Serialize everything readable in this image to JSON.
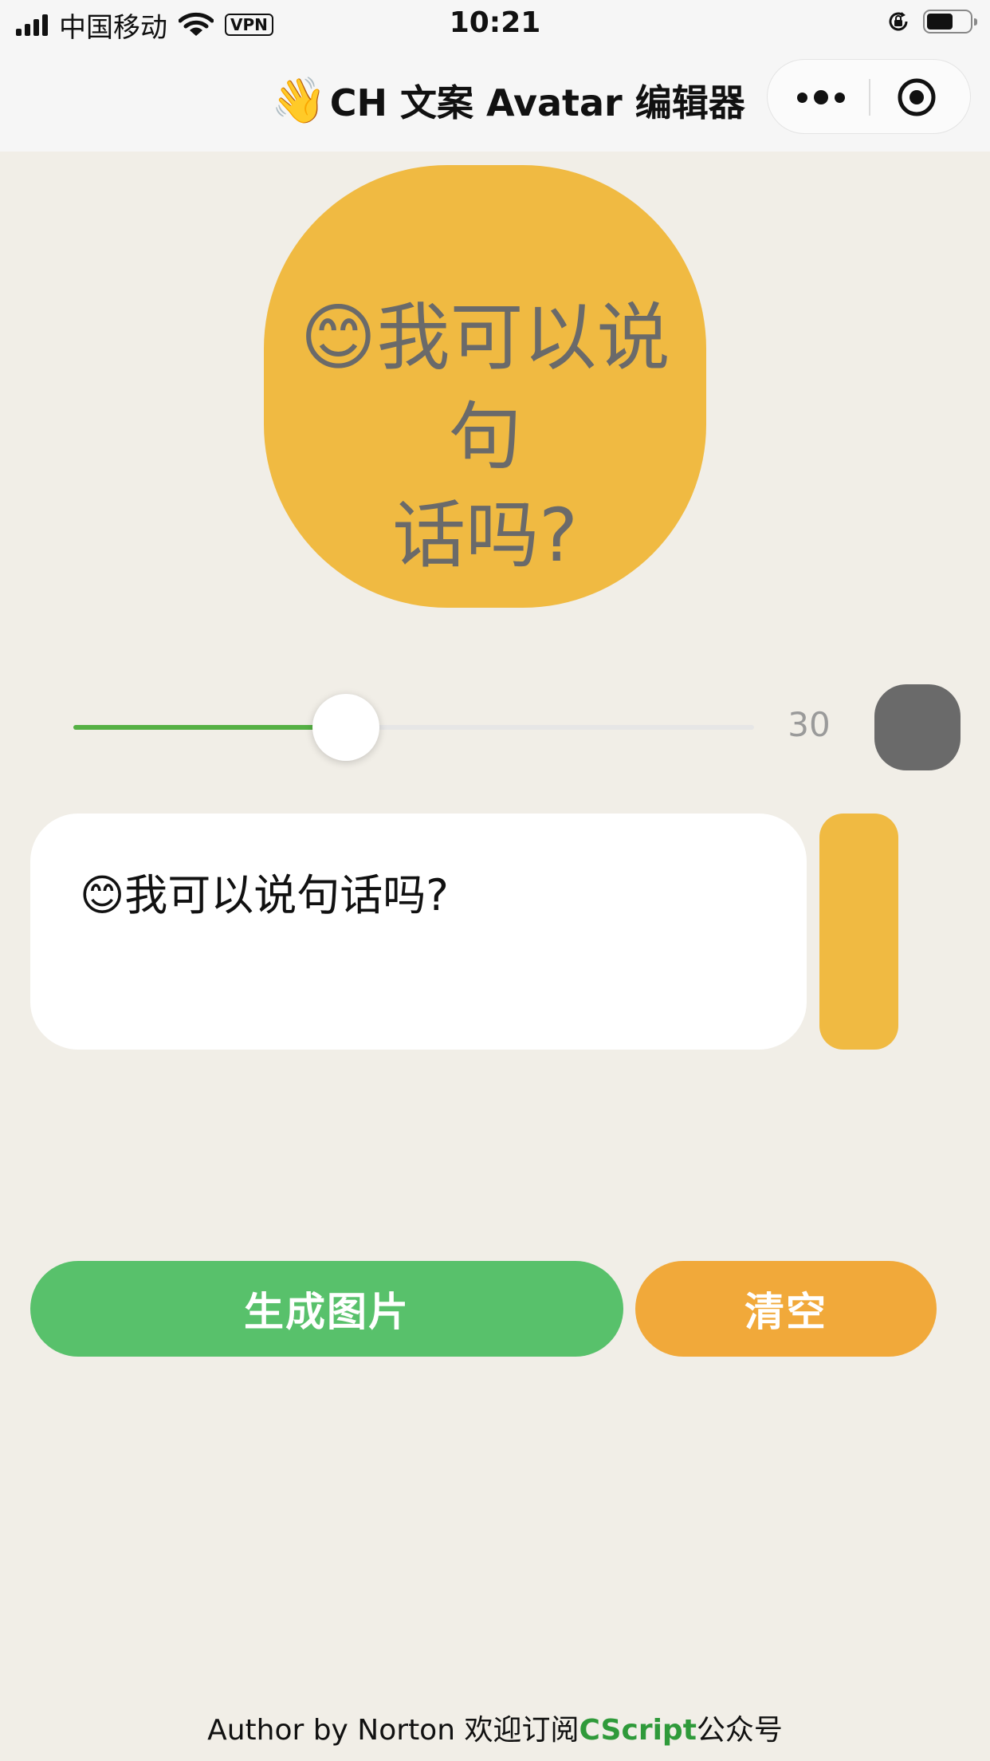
{
  "status_bar": {
    "carrier": "中国移动",
    "vpn": "VPN",
    "time": "10:21",
    "battery_level": 0.6
  },
  "nav": {
    "title_emoji": "👋",
    "title": "CH 文案 Avatar 编辑器"
  },
  "preview": {
    "line1": "😊我可以说句",
    "line2": "话吗?",
    "background_color": "#f0ba42",
    "text_color": "#6a6a6a"
  },
  "font_size_slider": {
    "value": "30",
    "fill_fraction": 0.4,
    "text_color_swatch": "#6a6a6a"
  },
  "editor": {
    "text": "😊我可以说句话吗?",
    "bg_color_swatch": "#f0ba42"
  },
  "buttons": {
    "generate": "生成图片",
    "clear": "清空"
  },
  "footer": {
    "prefix": "Author by Norton 欢迎订阅",
    "accent": "CScript",
    "suffix": "公众号"
  },
  "icons": [
    "signal-icon",
    "wifi-icon",
    "rotation-lock-icon",
    "battery-icon",
    "more-icon",
    "target-icon"
  ]
}
